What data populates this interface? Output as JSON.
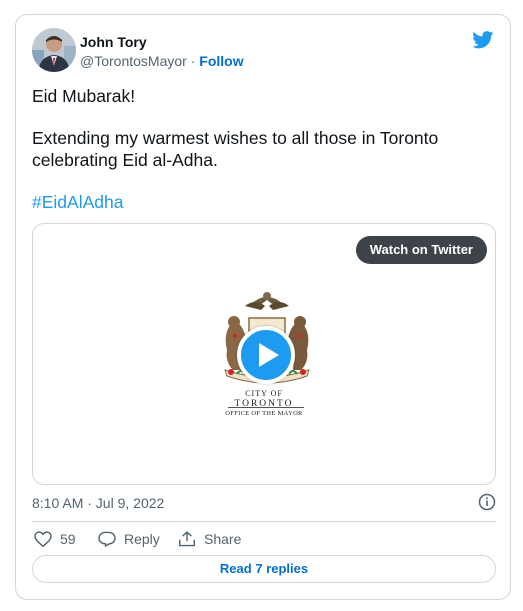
{
  "author": {
    "name": "John Tory",
    "handle": "@TorontosMayor",
    "separator": "·",
    "follow_label": "Follow"
  },
  "tweet": {
    "line1": "Eid Mubarak!",
    "line2": "Extending my warmest wishes to all those in Toronto celebrating Eid al-Adha.",
    "hashtag": "#EidAlAdha"
  },
  "media": {
    "watch_label": "Watch on Twitter",
    "city_of": "CITY OF",
    "toronto": "TORONTO",
    "office": "OFFICE OF THE MAYOR"
  },
  "timestamp": "8:10 AM · Jul 9, 2022",
  "actions": {
    "likes": "59",
    "reply_label": "Reply",
    "share_label": "Share"
  },
  "read_replies_label": "Read 7 replies",
  "colors": {
    "accent": "#1d9bf0",
    "link": "#006fd6",
    "secondary_text": "#536471",
    "border": "#cfd9de"
  },
  "icons": [
    "twitter-bird-icon",
    "play-icon",
    "info-icon",
    "heart-icon",
    "reply-icon",
    "share-icon"
  ]
}
